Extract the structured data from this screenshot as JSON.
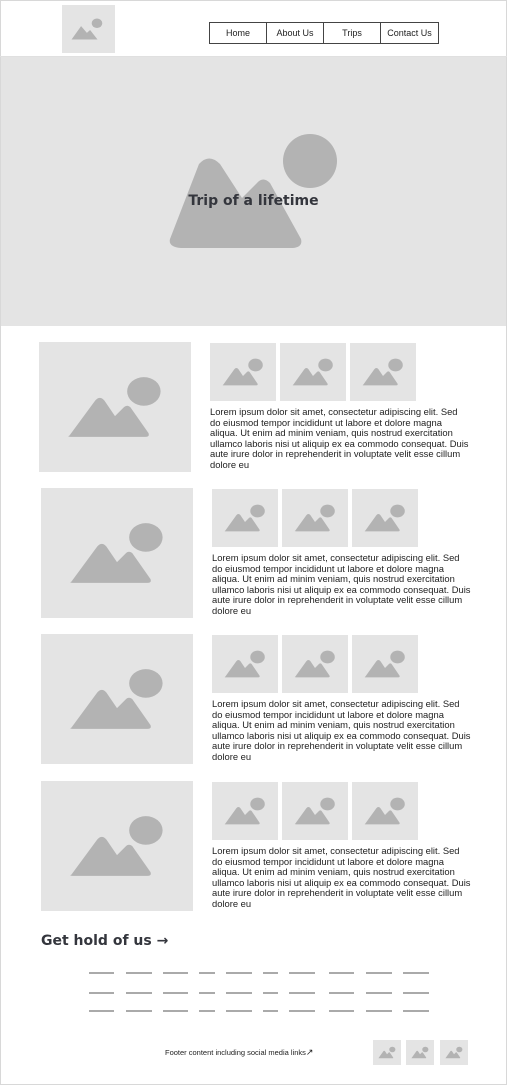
{
  "nav": {
    "items": [
      "Home",
      "About Us",
      "Trips",
      "Contact Us"
    ]
  },
  "hero": {
    "title": "Trip of a lifetime"
  },
  "trips": [
    {
      "description": "Lorem ipsum dolor sit amet, consectetur adipiscing elit. Sed do eiusmod tempor incididunt ut labore et dolore magna aliqua. Ut enim ad minim veniam, quis nostrud exercitation ullamco laboris nisi ut aliquip ex ea commodo consequat. Duis aute irure dolor in reprehenderit in voluptate velit esse cillum dolore eu"
    },
    {
      "description": "Lorem ipsum dolor sit amet, consectetur adipiscing elit. Sed do eiusmod tempor incididunt ut labore et dolore magna aliqua. Ut enim ad minim veniam, quis nostrud exercitation ullamco laboris nisi ut aliquip ex ea commodo consequat. Duis aute irure dolor in reprehenderit in voluptate velit esse cillum dolore eu"
    },
    {
      "description": "Lorem ipsum dolor sit amet, consectetur adipiscing elit. Sed do eiusmod tempor incididunt ut labore et dolore magna aliqua. Ut enim ad minim veniam, quis nostrud exercitation ullamco laboris nisi ut aliquip ex ea commodo consequat. Duis aute irure dolor in reprehenderit in voluptate velit esse cillum dolore eu"
    },
    {
      "description": "Lorem ipsum dolor sit amet, consectetur adipiscing elit. Sed do eiusmod tempor incididunt ut labore et dolore magna aliqua. Ut enim ad minim veniam, quis nostrud exercitation ullamco laboris nisi ut aliquip ex ea commodo consequat. Duis aute irure dolor in reprehenderit in voluptate velit esse cillum dolore eu"
    }
  ],
  "contact": {
    "heading": "Get hold of us →"
  },
  "footer": {
    "text": "Footer content including social media links",
    "link_icon": "external-link-icon"
  },
  "icons": {
    "image_placeholder": "image-placeholder-icon"
  },
  "colors": {
    "placeholder_bg": "#e4e4e4",
    "placeholder_shape": "#b3b3b3",
    "heading": "#34363d"
  }
}
